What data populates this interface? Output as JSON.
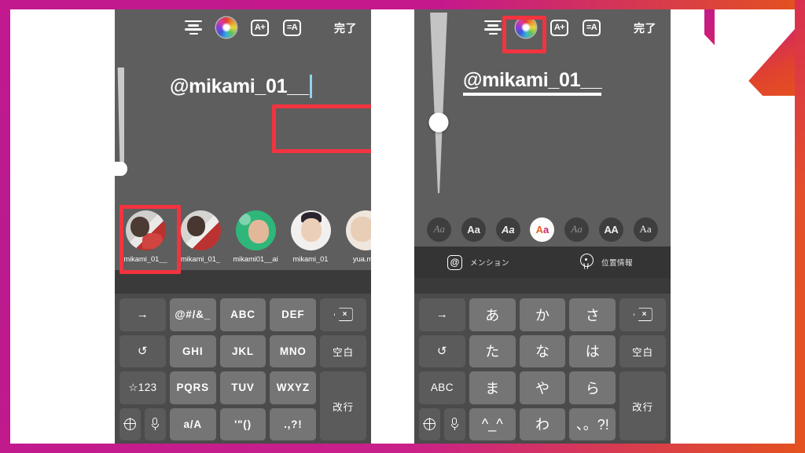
{
  "frame": {
    "accent_magenta": "#c2198f",
    "accent_orange": "#e4521f",
    "background": "#ffffff"
  },
  "highlight_color": "#f3333f",
  "panel_bg": "#5e5e5e",
  "left_panel": {
    "toolbar": {
      "align_icon": "align-left-icon",
      "color_wheel_icon": "color-wheel-icon",
      "text_effect_icon": "A+",
      "text_style_icon": "=A",
      "done_label": "完了"
    },
    "text_field": {
      "value": "@mikami_01__",
      "caret_visible": true,
      "highlighted": true
    },
    "suggestions": [
      {
        "username": "mikami_01__",
        "selected": true,
        "avatar": "avatar-1"
      },
      {
        "username": "mikami_01_",
        "selected": false,
        "avatar": "avatar-2"
      },
      {
        "username": "mikami01__ai",
        "selected": false,
        "avatar": "avatar-3"
      },
      {
        "username": "mikami_01",
        "selected": false,
        "avatar": "avatar-4"
      },
      {
        "username": "yua.mik",
        "selected": false,
        "avatar": "avatar-5"
      }
    ],
    "keyboard": {
      "type": "japanese-numeric-alpha",
      "rows": [
        [
          {
            "label": "→",
            "fn": true
          },
          {
            "label": "@#/&_"
          },
          {
            "label": "ABC"
          },
          {
            "label": "DEF"
          },
          {
            "label": "delete-icon",
            "fn": true,
            "icon": "delete-icon"
          }
        ],
        [
          {
            "label": "↺",
            "fn": true
          },
          {
            "label": "GHI"
          },
          {
            "label": "JKL"
          },
          {
            "label": "MNO"
          },
          {
            "label": "空白",
            "fn": true,
            "cjk": true
          }
        ],
        [
          {
            "label": "☆123",
            "fn": true
          },
          {
            "label": "PQRS"
          },
          {
            "label": "TUV"
          },
          {
            "label": "WXYZ"
          },
          {
            "label": "改行",
            "fn": true,
            "cjk": true
          }
        ],
        [
          {
            "label": "globe-mic",
            "fn": true
          },
          {
            "label": "a/A"
          },
          {
            "label": "'\"()"
          },
          {
            "label": ".,?!"
          }
        ]
      ]
    }
  },
  "right_panel": {
    "toolbar": {
      "align_icon": "align-left-icon",
      "color_wheel_icon": "color-wheel-icon",
      "color_wheel_highlighted": true,
      "text_effect_icon": "A+",
      "text_style_icon": "=A",
      "done_label": "完了"
    },
    "size_slider": {
      "name": "text-size-slider",
      "knob_position_pct": 61
    },
    "text_field": {
      "value": "@mikami_01__",
      "underlined": true
    },
    "font_chips": [
      {
        "label": "Aa",
        "style": "script",
        "selected": false
      },
      {
        "label": "Aa",
        "style": "bold",
        "selected": false
      },
      {
        "label": "Aa",
        "style": "bold-italic",
        "selected": false
      },
      {
        "label": "Aa",
        "style": "colored",
        "selected": true
      },
      {
        "label": "Aa",
        "style": "serif-italic",
        "selected": false
      },
      {
        "label": "AA",
        "style": "caps-bold",
        "selected": false
      },
      {
        "label": "Aa",
        "style": "serif",
        "selected": false
      }
    ],
    "action_bar": {
      "mention": {
        "icon": "at-sign-icon",
        "label": "メンション"
      },
      "location": {
        "icon": "location-pin-icon",
        "label": "位置情報"
      }
    },
    "keyboard": {
      "type": "japanese-kana",
      "rows": [
        [
          {
            "label": "→",
            "fn": true
          },
          {
            "label": "あ",
            "jp": true
          },
          {
            "label": "か",
            "jp": true
          },
          {
            "label": "さ",
            "jp": true
          },
          {
            "label": "delete-icon",
            "fn": true,
            "icon": "delete-icon"
          }
        ],
        [
          {
            "label": "↺",
            "fn": true
          },
          {
            "label": "た",
            "jp": true
          },
          {
            "label": "な",
            "jp": true
          },
          {
            "label": "は",
            "jp": true
          },
          {
            "label": "空白",
            "fn": true,
            "cjk": true
          }
        ],
        [
          {
            "label": "ABC",
            "fn": true
          },
          {
            "label": "ま",
            "jp": true
          },
          {
            "label": "や",
            "jp": true
          },
          {
            "label": "ら",
            "jp": true
          },
          {
            "label": "改行",
            "fn": true,
            "cjk": true
          }
        ],
        [
          {
            "label": "globe-mic",
            "fn": true
          },
          {
            "label": "^_^",
            "jp": true
          },
          {
            "label": "わ",
            "jp": true
          },
          {
            "label": "、。?!",
            "jp": true
          }
        ]
      ]
    }
  }
}
